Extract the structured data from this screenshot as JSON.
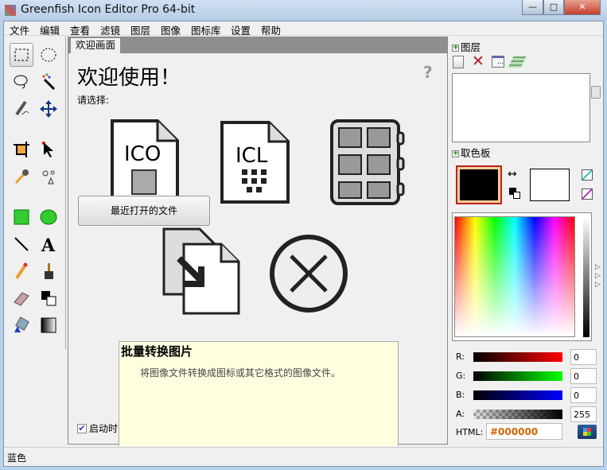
{
  "window": {
    "title": "Greenfish Icon Editor Pro 64-bit",
    "controls": [
      "minimize",
      "maximize",
      "close"
    ]
  },
  "menu": [
    "文件",
    "编辑",
    "查看",
    "滤镜",
    "图层",
    "图像",
    "图标库",
    "设置",
    "帮助"
  ],
  "tools": [
    "rect-select",
    "ellipse-select",
    "lasso",
    "magic-wand",
    "pen-select",
    "move",
    "crop",
    "pointer",
    "eyedropper",
    "color-effects",
    "rectangle",
    "ellipse",
    "line",
    "text",
    "pencil",
    "brush",
    "eraser",
    "color-swap",
    "fill",
    "gradient"
  ],
  "doc": {
    "tab": "欢迎画面",
    "welcome": "欢迎使用！",
    "choose": "请选择:",
    "ico_label": "ICO",
    "icl_label": "ICL",
    "recent_button": "最近打开的文件",
    "info_title": "批量转换图片",
    "info_desc": "将图像文件转换成图标或其它格式的图像文件。",
    "startup_label": "启动时",
    "startup_checked": true
  },
  "right": {
    "layers_title": "图层",
    "palette_title": "取色板",
    "r_label": "R:",
    "r_value": "0",
    "g_label": "G:",
    "g_value": "0",
    "b_label": "B:",
    "b_value": "0",
    "a_label": "A:",
    "a_value": "255",
    "html_label": "HTML:",
    "html_value": "#000000",
    "primary_color": "#000000",
    "secondary_color": "#ffffff"
  },
  "status": "蓝色"
}
